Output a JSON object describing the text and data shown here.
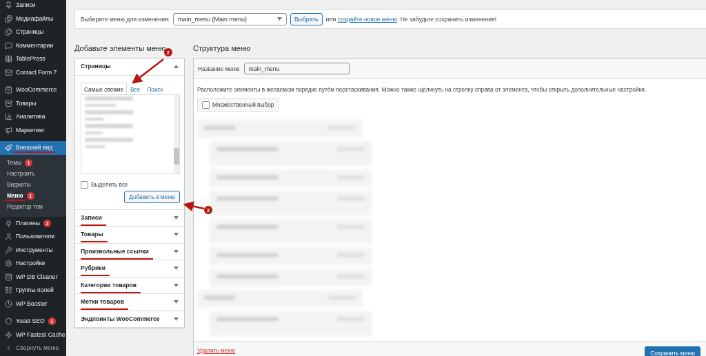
{
  "sidebar": {
    "groups": [
      {
        "items": [
          {
            "label": "Записи",
            "selected": false,
            "underlined": false
          },
          {
            "label": "Медиафайлы",
            "selected": false,
            "underlined": false
          },
          {
            "label": "Страницы",
            "selected": false,
            "underlined": false
          },
          {
            "label": "Комментарии",
            "selected": false,
            "underlined": false
          },
          {
            "label": "TablePress",
            "selected": false,
            "underlined": false
          },
          {
            "label": "Contact Form 7",
            "selected": false,
            "underlined": false
          }
        ]
      },
      {
        "items": [
          {
            "label": "WooCommerce",
            "selected": false,
            "underlined": false
          },
          {
            "label": "Товары",
            "selected": false,
            "underlined": false
          },
          {
            "label": "Аналитика",
            "selected": false,
            "underlined": false
          },
          {
            "label": "Маркетинг",
            "selected": false,
            "underlined": false
          }
        ]
      },
      {
        "items": [
          {
            "label": "Внешний вид",
            "selected": true,
            "underlined": true,
            "submenu": [
              {
                "label": "Темы",
                "badge": "1",
                "selected": false,
                "underlined": false
              },
              {
                "label": "Настроить",
                "selected": false,
                "underlined": false
              },
              {
                "label": "Виджеты",
                "selected": false,
                "underlined": false
              },
              {
                "label": "Меню",
                "badge": "1",
                "selected": true,
                "underlined": true
              },
              {
                "label": "Редактор тем",
                "selected": false,
                "underlined": false
              }
            ]
          },
          {
            "label": "Плагины",
            "badge": "2",
            "selected": false,
            "underlined": false
          },
          {
            "label": "Пользователи",
            "selected": false,
            "underlined": false
          },
          {
            "label": "Инструменты",
            "selected": false,
            "underlined": false
          },
          {
            "label": "Настройки",
            "selected": false,
            "underlined": false
          },
          {
            "label": "WP DB Cleaner",
            "selected": false,
            "underlined": false
          },
          {
            "label": "Группы полей",
            "selected": false,
            "underlined": false
          },
          {
            "label": "WP Booster",
            "selected": false,
            "underlined": false
          }
        ]
      },
      {
        "items": [
          {
            "label": "Yoast SEO",
            "badge": "1",
            "selected": false,
            "underlined": false
          },
          {
            "label": "WP Fastest Cache",
            "selected": false,
            "underlined": false
          },
          {
            "label": "Свернуть меню",
            "selected": false,
            "underlined": false,
            "kind": "collapse"
          }
        ]
      }
    ]
  },
  "menu_select_bar": {
    "label": "Выберите меню для изменения:",
    "select_value": "main_menu (Main menu)",
    "button": "Выбрать",
    "text_before_link": "или",
    "link": "создайте новое меню",
    "text_after_link": ". Не забудьте сохранить изменения!"
  },
  "add_items": {
    "heading": "Добавьте элементы меню",
    "sections": [
      {
        "title": "Страницы",
        "expanded": true,
        "underlined": false,
        "tabs": [
          {
            "label": "Самые свежие",
            "selected": true
          },
          {
            "label": "Все",
            "selected": false
          },
          {
            "label": "Поиск",
            "selected": false
          }
        ],
        "select_all": {
          "label": "Выделить все",
          "checked": false
        },
        "add_button": "Добавить в меню"
      },
      {
        "title": "Записи",
        "expanded": false,
        "underlined": true
      },
      {
        "title": "Товары",
        "expanded": false,
        "underlined": true
      },
      {
        "title": "Произвольные ссылки",
        "expanded": false,
        "underlined": true
      },
      {
        "title": "Рубрики",
        "expanded": false,
        "underlined": true
      },
      {
        "title": "Категории товаров",
        "expanded": false,
        "underlined": true
      },
      {
        "title": "Метки товаров",
        "expanded": false,
        "underlined": true
      },
      {
        "title": "Эндпоинты WooCommerce",
        "expanded": false,
        "underlined": false
      }
    ]
  },
  "menu_structure": {
    "heading": "Структура меню",
    "name_label": "Название меню",
    "name_value": "main_menu",
    "instructions": "Расположите элементы в желаемом порядке путём перетаскивания. Можно также щёлкнуть на стрелку справа от элемента, чтобы открыть дополнительные настройки.",
    "bulk_select": {
      "label": "Множественный выбор",
      "checked": false
    },
    "delete_link": "Удалить меню",
    "save_button": "Сохранить меню"
  },
  "annotations": [
    {
      "number": "2"
    },
    {
      "number": "3"
    }
  ]
}
